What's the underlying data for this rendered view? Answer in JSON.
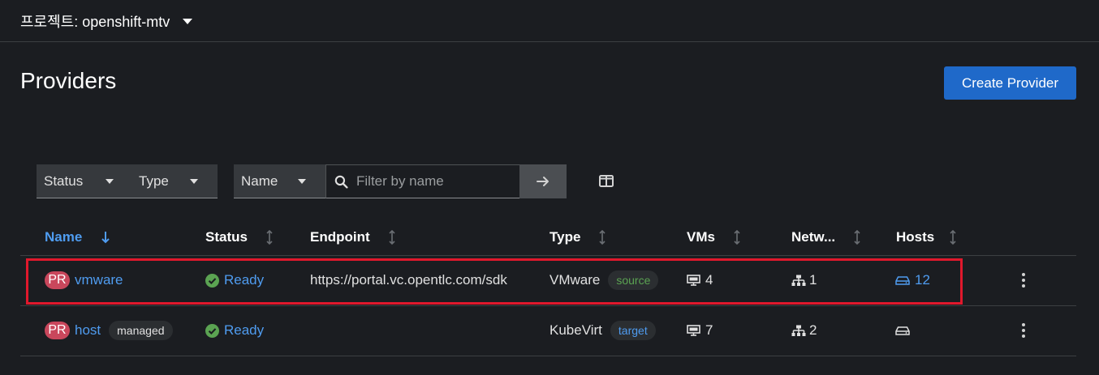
{
  "header": {
    "project_label": "프로젝트: openshift-mtv"
  },
  "page": {
    "title": "Providers",
    "create_button": "Create Provider"
  },
  "toolbar": {
    "status_filter": "Status",
    "type_filter": "Type",
    "name_filter": "Name",
    "search_placeholder": "Filter by name"
  },
  "table": {
    "columns": [
      "Name",
      "Status",
      "Endpoint",
      "Type",
      "VMs",
      "Netw...",
      "Hosts"
    ],
    "rows": [
      {
        "badge": "PR",
        "name": "vmware",
        "name_tag": "",
        "status": "Ready",
        "endpoint": "https://portal.vc.opentlc.com/sdk",
        "type": "VMware",
        "type_tag": "source",
        "vms": "4",
        "networks": "1",
        "hosts": "12"
      },
      {
        "badge": "PR",
        "name": "host",
        "name_tag": "managed",
        "status": "Ready",
        "endpoint": "",
        "type": "KubeVirt",
        "type_tag": "target",
        "vms": "7",
        "networks": "2",
        "hosts": ""
      }
    ]
  },
  "colors": {
    "accent": "#1f69c9",
    "link": "#4f9cf0",
    "ready": "#5ba352",
    "badge": "#c9475c",
    "highlight": "#e0182c"
  }
}
